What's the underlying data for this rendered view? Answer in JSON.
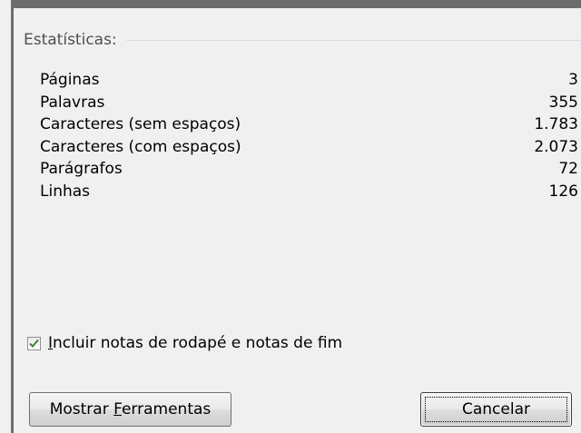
{
  "statistics": {
    "group_label": "Estatísticas:",
    "rows": [
      {
        "label": "Páginas",
        "value": "3"
      },
      {
        "label": "Palavras",
        "value": "355"
      },
      {
        "label": "Caracteres (sem espaços)",
        "value": "1.783"
      },
      {
        "label": "Caracteres (com espaços)",
        "value": "2.073"
      },
      {
        "label": "Parágrafos",
        "value": "72"
      },
      {
        "label": "Linhas",
        "value": "126"
      }
    ]
  },
  "options": {
    "include_notes_label": "Incluir notas de rodapé e notas de fim",
    "include_notes_checked": true
  },
  "buttons": {
    "tools_label": "Mostrar Ferramentas",
    "cancel_label": "Cancelar"
  },
  "colors": {
    "background": "#f0f0f0",
    "frame": "#6d6d6d",
    "group_line": "#d5dfe5",
    "check": "#3a7e3a"
  }
}
